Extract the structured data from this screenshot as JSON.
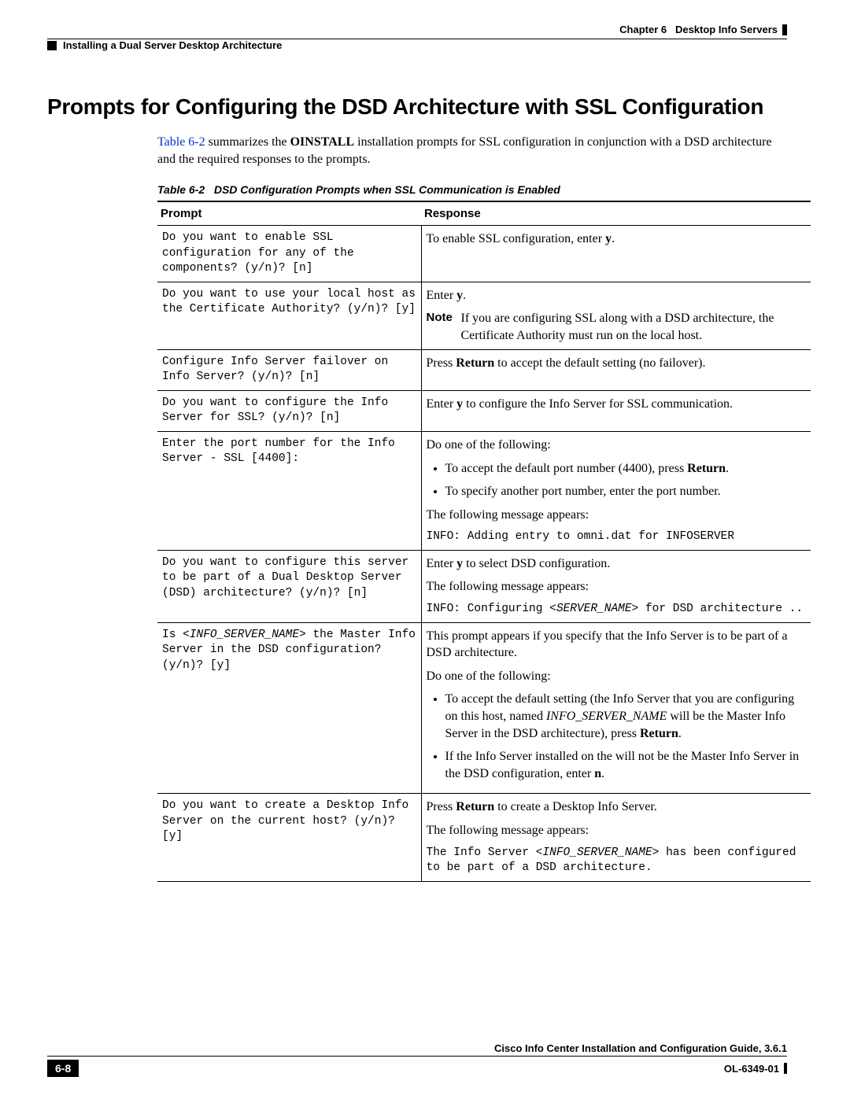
{
  "header": {
    "chapter": "Chapter 6",
    "chapterTitle": "Desktop Info Servers",
    "breadcrumb": "Installing a Dual Server Desktop Architecture"
  },
  "title": "Prompts for Configuring the DSD Architecture with SSL Configuration",
  "intro": {
    "link": "Table 6-2",
    "p1a": " summarizes the ",
    "p1b": "OINSTALL",
    "p1c": " installation prompts for SSL configuration in conjunction with a DSD architecture and the required responses to the prompts."
  },
  "caption": {
    "num": "Table 6-2",
    "text": "DSD Configuration Prompts when SSL Communication is Enabled"
  },
  "th": {
    "prompt": "Prompt",
    "response": "Response"
  },
  "rows": {
    "r1": {
      "prompt": "Do you want to enable SSL configuration for any of the components? (y/n)? [n]",
      "resp_a": "To enable SSL configuration, enter ",
      "resp_b": "y",
      "resp_c": "."
    },
    "r2": {
      "prompt": "Do you want to use your local host as the Certificate Authority? (y/n)? [y]",
      "resp_a": "Enter ",
      "resp_b": "y",
      "resp_c": ".",
      "note_label": "Note",
      "note": "If you are configuring SSL along with a DSD architecture, the Certificate Authority must run on the local host."
    },
    "r3": {
      "prompt": "Configure Info Server failover on Info Server?  (y/n)? [n]",
      "resp_a": "Press ",
      "resp_b": "Return",
      "resp_c": " to accept the default setting (no failover)."
    },
    "r4": {
      "prompt": "Do you want to configure the Info Server for SSL? (y/n)? [n]",
      "resp_a": "Enter ",
      "resp_b": "y",
      "resp_c": " to configure the Info Server for SSL communication."
    },
    "r5": {
      "prompt": "Enter the port number for the Info Server - SSL [4400]:",
      "lead": "Do one of the following:",
      "li1a": "To accept the default port number (4400), press ",
      "li1b": "Return",
      "li1c": ".",
      "li2": "To specify another port number, enter the port number.",
      "msg_intro": "The following message appears:",
      "msg": "INFO: Adding entry to omni.dat for INFOSERVER"
    },
    "r6": {
      "prompt": "Do you want to configure this server to be part of a Dual Desktop Server (DSD) architecture? (y/n)? [n]",
      "p1a": "Enter ",
      "p1b": "y",
      "p1c": " to select DSD configuration.",
      "msg_intro": "The following message appears:",
      "msg_a": "INFO: Configuring ",
      "msg_b": "<SERVER_NAME>",
      "msg_c": " for DSD architecture .."
    },
    "r7": {
      "prompt_a": "Is ",
      "prompt_b": "<INFO_SERVER_NAME>",
      "prompt_c": " the Master Info Server in the DSD configuration? (y/n)? [y]",
      "p1": "This prompt appears if you specify that the Info Server is to be part of a DSD architecture.",
      "p2": "Do one of the following:",
      "li1a": "To accept the default setting (the Info Server that you are configuring on this host, named ",
      "li1b": "INFO_SERVER_NAME",
      "li1c": " will be the Master Info Server in the DSD architecture), press ",
      "li1d": "Return",
      "li1e": ".",
      "li2a": "If the Info Server installed on the will not be the Master Info Server in the DSD configuration, enter ",
      "li2b": "n",
      "li2c": "."
    },
    "r8": {
      "prompt": "Do you want to create a Desktop Info Server on the current host? (y/n)? [y]",
      "p1a": "Press ",
      "p1b": "Return",
      "p1c": " to create a Desktop Info Server.",
      "msg_intro": "The following message appears:",
      "msg_a": "The Info Server ",
      "msg_b": "<INFO_SERVER_NAME>",
      "msg_c": " has been configured to be part of a DSD architecture."
    }
  },
  "footer": {
    "book": "Cisco Info Center Installation and Configuration Guide, 3.6.1",
    "page": "6-8",
    "doc": "OL-6349-01"
  }
}
